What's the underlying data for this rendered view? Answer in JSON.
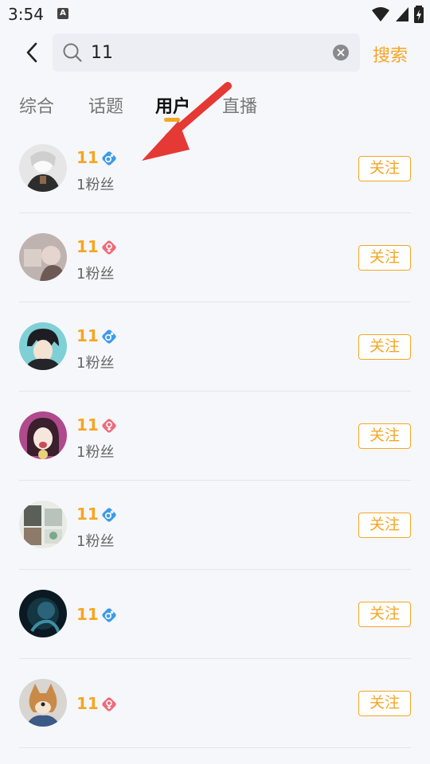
{
  "status_bar": {
    "time": "3:54",
    "a_badge": "A"
  },
  "search": {
    "value": "11",
    "button_label": "搜索"
  },
  "tabs": [
    {
      "label": "综合",
      "active": false
    },
    {
      "label": "话题",
      "active": false
    },
    {
      "label": "用户",
      "active": true
    },
    {
      "label": "直播",
      "active": false
    }
  ],
  "colors": {
    "accent": "#f5a623",
    "male": "#3d9be9",
    "female": "#ef6b7a",
    "annotation_arrow": "#e53935"
  },
  "users": [
    {
      "name": "11",
      "gender": "male",
      "fans": "1粉丝",
      "follow_label": "关注"
    },
    {
      "name": "11",
      "gender": "female",
      "fans": "1粉丝",
      "follow_label": "关注"
    },
    {
      "name": "11",
      "gender": "male",
      "fans": "1粉丝",
      "follow_label": "关注"
    },
    {
      "name": "11",
      "gender": "female",
      "fans": "1粉丝",
      "follow_label": "关注"
    },
    {
      "name": "11",
      "gender": "male",
      "fans": "1粉丝",
      "follow_label": "关注"
    },
    {
      "name": "11",
      "gender": "male",
      "fans": "",
      "follow_label": "关注"
    },
    {
      "name": "11",
      "gender": "female",
      "fans": "",
      "follow_label": "关注"
    }
  ]
}
